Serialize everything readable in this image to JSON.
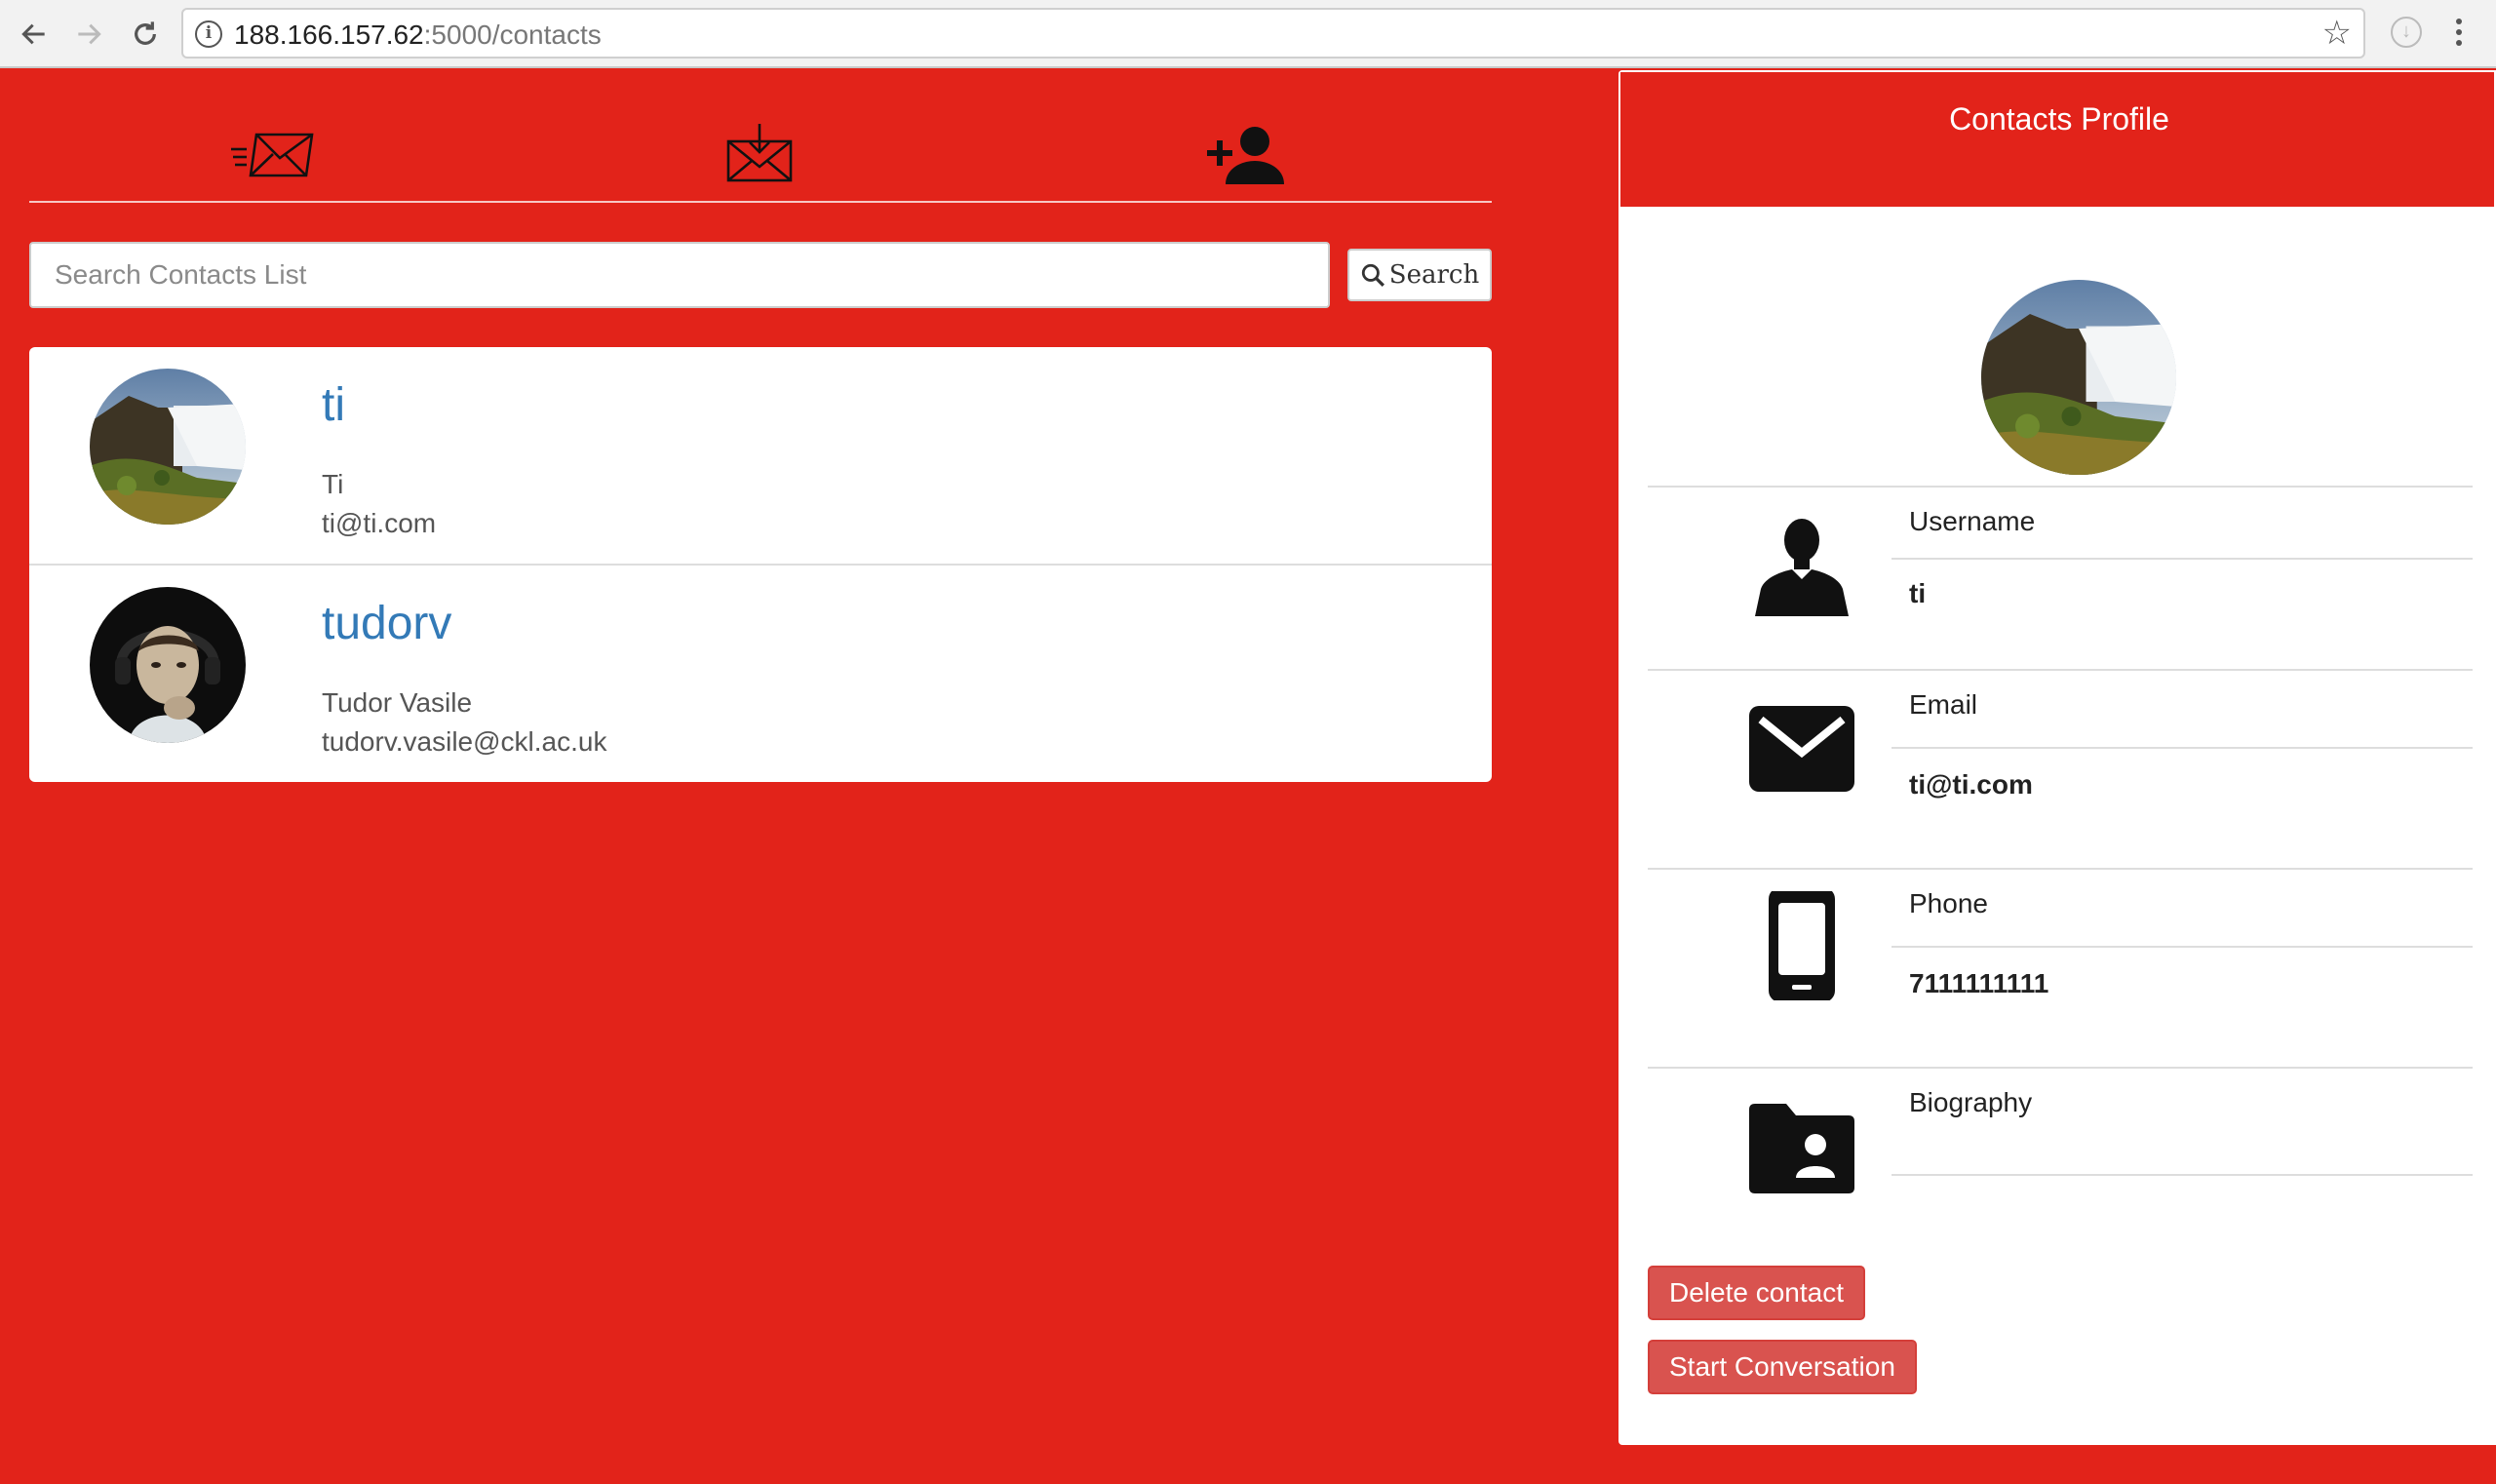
{
  "browser": {
    "url_host": "188.166.157.62",
    "url_path": ":5000/contacts"
  },
  "tabs": [
    {
      "name": "sent-messages",
      "icon": "send-mail-icon"
    },
    {
      "name": "inbox",
      "icon": "inbox-mail-icon"
    },
    {
      "name": "add-contact",
      "icon": "add-person-icon",
      "active": true
    }
  ],
  "search": {
    "placeholder": "Search Contacts List",
    "button_label": "Search"
  },
  "contacts": [
    {
      "username": "ti",
      "full_name": "Ti",
      "email": "ti@ti.com",
      "avatar": "waterfall-photo"
    },
    {
      "username": "tudorv",
      "full_name": "Tudor Vasile",
      "email": "tudorv.vasile@ckl.ac.uk",
      "avatar": "person-photo"
    }
  ],
  "profile": {
    "title": "Contacts Profile",
    "username_label": "Username",
    "username_value": "ti",
    "email_label": "Email",
    "email_value": "ti@ti.com",
    "phone_label": "Phone",
    "phone_value": "7111111111",
    "bio_label": "Biography",
    "bio_value": "",
    "delete_label": "Delete contact",
    "start_label": "Start Conversation"
  },
  "colors": {
    "background": "#e2231a",
    "link": "#337ab7",
    "danger_button": "#d9534f"
  }
}
